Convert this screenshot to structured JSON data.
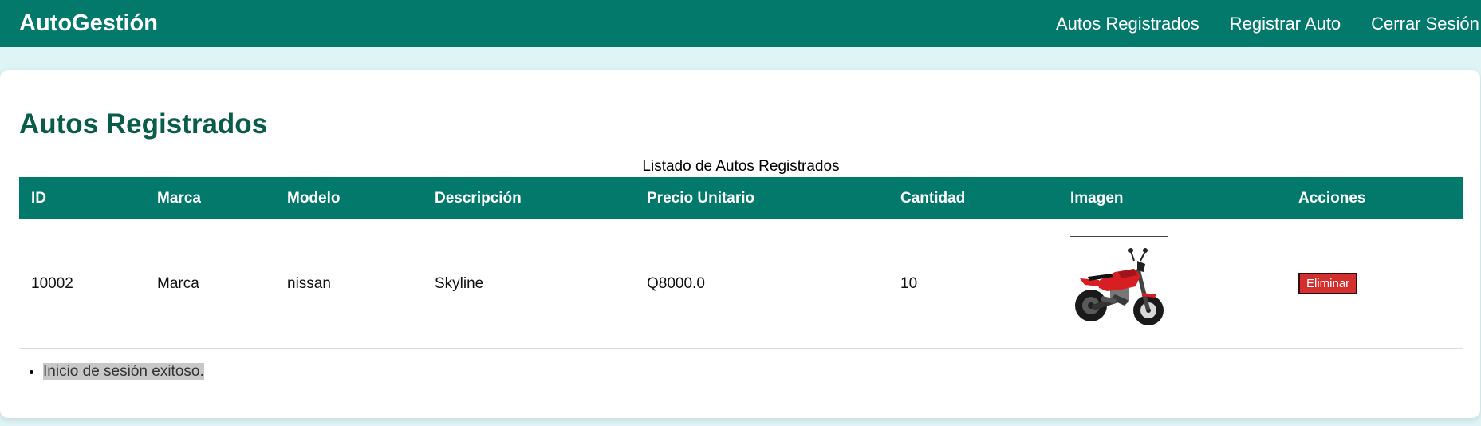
{
  "navbar": {
    "brand": "AutoGestión",
    "links": [
      "Autos Registrados",
      "Registrar Auto",
      "Cerrar Sesión"
    ]
  },
  "page": {
    "title": "Autos Registrados",
    "caption": "Listado de Autos Registrados"
  },
  "table": {
    "headers": [
      "ID",
      "Marca",
      "Modelo",
      "Descripción",
      "Precio Unitario",
      "Cantidad",
      "Imagen",
      "Acciones"
    ],
    "rows": [
      {
        "id": "10002",
        "marca": "Marca",
        "modelo": "nissan",
        "descripcion": "Skyline",
        "precio": "Q8000.0",
        "cantidad": "10",
        "image_icon": "motorcycle-image",
        "action_label": "Eliminar"
      }
    ]
  },
  "messages": [
    "Inicio de sesión exitoso."
  ],
  "colors": {
    "navbar": "#02796b",
    "title": "#0a5c4a",
    "danger": "#d32f2f",
    "background": "#def4f5"
  }
}
